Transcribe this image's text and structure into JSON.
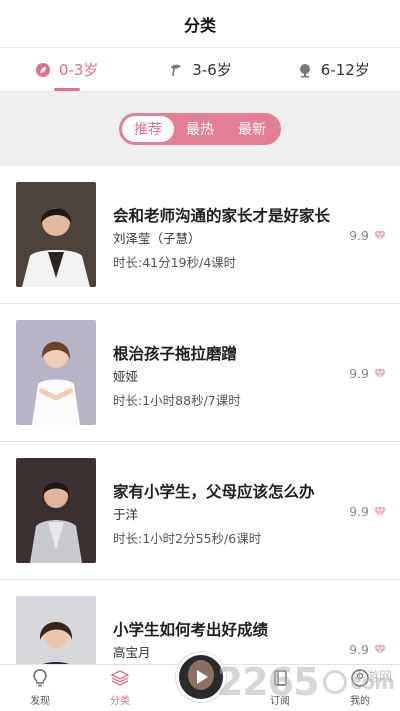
{
  "header": {
    "title": "分类"
  },
  "age_tabs": [
    {
      "label": "0-3岁",
      "icon": "leaf-icon",
      "active": true
    },
    {
      "label": "3-6岁",
      "icon": "sprout-icon",
      "active": false
    },
    {
      "label": "6-12岁",
      "icon": "tree-icon",
      "active": false
    }
  ],
  "sort_filter": [
    {
      "label": "推荐",
      "active": true
    },
    {
      "label": "最热",
      "active": false
    },
    {
      "label": "最新",
      "active": false
    }
  ],
  "courses": [
    {
      "title": "会和老师沟通的家长才是好家长",
      "author": "刘泽莹（子慧）",
      "meta": "时长:41分19秒/4课时",
      "price": "9.9"
    },
    {
      "title": "根治孩子拖拉磨蹭",
      "author": "娅娅",
      "meta": "时长:1小时88秒/7课时",
      "price": "9.9"
    },
    {
      "title": "家有小学生，父母应该怎么办",
      "author": "于洋",
      "meta": "时长:1小时2分55秒/6课时",
      "price": "9.9"
    },
    {
      "title": "小学生如何考出好成绩",
      "author": "高宝月",
      "meta": "",
      "price": "9.9"
    }
  ],
  "tabbar": [
    {
      "label": "发现",
      "icon": "lightbulb-icon",
      "active": false
    },
    {
      "label": "分类",
      "icon": "layers-icon",
      "active": true
    },
    {
      "label": "",
      "icon": "play-icon",
      "active": false
    },
    {
      "label": "订阅",
      "icon": "book-icon",
      "active": false
    },
    {
      "label": "我的",
      "icon": "user-icon",
      "active": false
    }
  ],
  "watermark": {
    "number": "2265",
    "suffix": "com",
    "site": "手游网"
  },
  "colors": {
    "accent": "#e07090",
    "segment_bg": "#e47f98",
    "filter_bg": "#efefef"
  }
}
